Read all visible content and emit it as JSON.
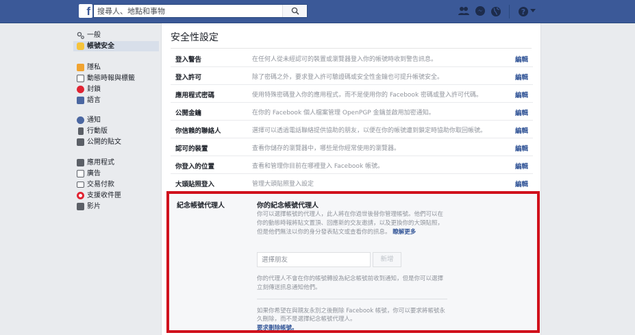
{
  "header": {
    "logo": "f",
    "search_placeholder": "搜尋人、地點和事物",
    "icons": [
      "friends-icon",
      "messages-icon",
      "notifications-globe-icon",
      "help-icon",
      "dropdown-caret-icon"
    ]
  },
  "sidebar": {
    "items": [
      {
        "label": "一般",
        "icon": "gear-icon"
      },
      {
        "label": "帳號安全",
        "icon": "shield-icon",
        "active": true
      },
      {
        "label": "隱私",
        "icon": "privacy-lock-icon"
      },
      {
        "label": "動態時報與標籤",
        "icon": "timeline-icon"
      },
      {
        "label": "封鎖",
        "icon": "block-icon"
      },
      {
        "label": "語言",
        "icon": "language-icon"
      },
      {
        "label": "通知",
        "icon": "globe-icon"
      },
      {
        "label": "行動版",
        "icon": "mobile-icon"
      },
      {
        "label": "公開的貼文",
        "icon": "rss-icon"
      },
      {
        "label": "應用程式",
        "icon": "apps-icon"
      },
      {
        "label": "廣告",
        "icon": "ads-icon"
      },
      {
        "label": "交易付款",
        "icon": "payments-icon"
      },
      {
        "label": "支援收件匣",
        "icon": "support-icon"
      },
      {
        "label": "影片",
        "icon": "video-icon"
      }
    ]
  },
  "main": {
    "title": "安全性設定",
    "edit_label": "編輯",
    "rows": [
      {
        "title": "登入警告",
        "desc": "在任何人從未經認可的裝置或瀏覽器登入你的帳號時收到警告訊息。"
      },
      {
        "title": "登入許可",
        "desc": "除了密碼之外，要求登入許可驗證碼或安全性金鑰也可提升帳號安全。"
      },
      {
        "title": "應用程式密碼",
        "desc": "使用特殊密碼登入你的應用程式，而不是使用你的 Facebook 密碼或登入許可代碼。"
      },
      {
        "title": "公開金鑰",
        "desc": "在你的 Facebook 個人檔案管理 OpenPGP 金鑰並啟用加密通知。"
      },
      {
        "title": "你信賴的聯絡人",
        "desc": "選擇可以透過電話聯絡提供協助的朋友，以便在你的帳號遭到鎖定時協助你取回帳號。"
      },
      {
        "title": "認可的裝置",
        "desc": "查看你儲存的瀏覽器中，哪些是你經常使用的瀏覽器。"
      },
      {
        "title": "你登入的位置",
        "desc": "查看和管理你目前在哪裡登入 Facebook 帳號。"
      },
      {
        "title": "大頭貼照登入",
        "desc": "管理大頭貼照登入設定"
      }
    ]
  },
  "legacy": {
    "label": "紀念帳號代理人",
    "heading": "你的紀念帳號代理人",
    "desc": "你可以選擇帳號的代理人，此人將在你過世後替你管理帳號。他們可以在你的動態時報將貼文置頂、回應新的交友邀請，以及更換你的大頭貼照，但是他們無法以你的身分發表貼文或查看你的訊息。",
    "learn_more": "瞭解更多",
    "input_placeholder": "選擇朋友",
    "add_button": "新增",
    "note": "你的代理人不會在你的帳號轉設為紀念帳號前收到通知，但是你可以選擇立刻傳送訊息通知他們。",
    "delete_text": "如果你希望在與親友永別之後刪除 Facebook 帳號，你可以要求將帳號永久刪除，而不是選擇紀念帳號代理人。",
    "delete_link": "要求刪除帳號。"
  },
  "colors": {
    "brand": "#3b5998",
    "link": "#365899",
    "highlight": "#d0111c"
  }
}
